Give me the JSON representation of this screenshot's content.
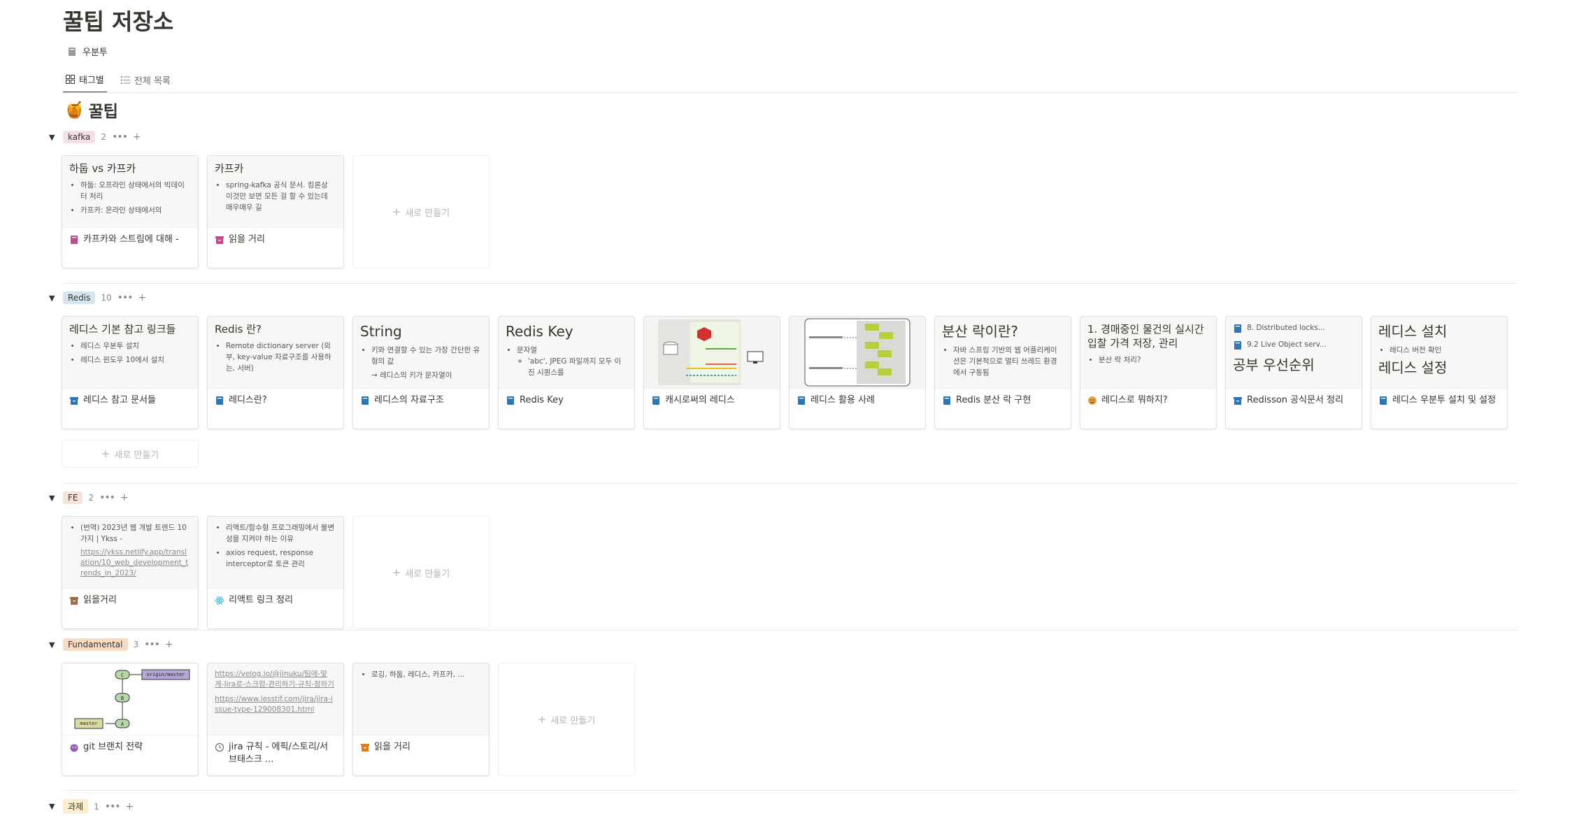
{
  "page": {
    "title": "꿀팁 저장소",
    "breadcrumb": "우분투"
  },
  "tabs": [
    {
      "label": "태그별"
    },
    {
      "label": "전체 목록"
    }
  ],
  "section": {
    "emoji": "🍯",
    "title": "꿀팁"
  },
  "common": {
    "new_label": "새로 만들기",
    "more_icon": "•••",
    "plus_icon": "+",
    "toggle_icon": "▼"
  },
  "groups": [
    {
      "tag": "kafka",
      "count": "2",
      "color": "#f5e0e9",
      "cards": [
        {
          "name": "카프카와 스트림에 대해 -",
          "icon": "book",
          "icon_color": "#c14c8a",
          "preview_title": "하둡 vs 카프카",
          "bullets": [
            "하둡: 오프라인 상태에서의 빅데이터 처리",
            "카프카: 온라인 상태에서의"
          ]
        },
        {
          "name": "읽을 거리",
          "icon": "archive",
          "icon_color": "#c14c8a",
          "preview_title": "카프카",
          "bullets": [
            "spring-kafka 공식 문서. 킹론상 이것만 보면 모든 걸 할 수 있는데 매우매우 길"
          ]
        }
      ]
    },
    {
      "tag": "Redis",
      "count": "10",
      "color": "#d3e5ef",
      "cards": [
        {
          "name": "레디스 참고 문서들",
          "icon": "archive",
          "icon_color": "#2e75b6",
          "preview_title": "레디스 기본 참고 링크들",
          "bullets": [
            "레디스 우분투 설치",
            "레디스 윈도우 10에서 설치"
          ]
        },
        {
          "name": "레디스란?",
          "icon": "book",
          "icon_color": "#2e75b6",
          "preview_title": "Redis 란?",
          "bullets": [
            "Remote dictionary server (외부, key-value 자료구조를 사용하는, 서버)"
          ]
        },
        {
          "name": "레디스의 자료구조",
          "icon": "book",
          "icon_color": "#2e75b6",
          "preview_title": "String",
          "bullets": [
            "키와 연결할 수 있는 가장 간단한 유형의 값"
          ],
          "extra": "→ 레디스의 키가 문자열이"
        },
        {
          "name": "Redis Key",
          "icon": "book",
          "icon_color": "#2e75b6",
          "preview_title": "Redis Key",
          "bullets": [
            "문자열"
          ],
          "sub": "'abc', JPEG 파일까지 모두 이진 시퀀스를"
        },
        {
          "name": "캐시로써의 레디스",
          "icon": "book",
          "icon_color": "#2e75b6",
          "image": "cache"
        },
        {
          "name": "레디스 활용 사례",
          "icon": "book",
          "icon_color": "#2e75b6",
          "image": "usecase"
        },
        {
          "name": "Redis 분산 락 구현",
          "icon": "book",
          "icon_color": "#2e75b6",
          "preview_title": "분산 락이란?",
          "bullets": [
            "자바 스프링 기반의 웹 어플리케이션은 기본적으로 멀티 쓰레드 환경에서 구동됨"
          ]
        },
        {
          "name": "레디스로 뭐하지?",
          "icon": "face",
          "icon_color": "#e9a23b",
          "preview_title": "1. 경매중인 물건의 실시간 입찰 가격 저장, 관리",
          "bullets": [
            "분산 락 처리?"
          ]
        },
        {
          "name": "Redisson 공식문서 정리",
          "icon": "archive",
          "icon_color": "#2e75b6",
          "links": [
            "8. Distributed locks...",
            "9.2 Live Object serv..."
          ],
          "preview_title": "공부 우선순위"
        },
        {
          "name": "레디스 우분투 설치 및 설정",
          "icon": "book",
          "icon_color": "#2e75b6",
          "preview_title": "레디스 설치",
          "bullets": [
            "레디스 버전 확인"
          ],
          "extra": "레디스 설정"
        }
      ]
    },
    {
      "tag": "FE",
      "count": "2",
      "color": "#f3e3d6",
      "cards": [
        {
          "name": "읽을거리",
          "icon": "archive",
          "icon_color": "#9a6a4a",
          "bullets": [
            "(번역) 2023년 웹 개발 트렌드 10가지 | Ykss -"
          ],
          "link": "https://ykss.netlify.app/translation/10_web_development_trends_in_2023/"
        },
        {
          "name": "리액트 링크 정리",
          "icon": "react",
          "icon_color": "#4bc0e0",
          "bullets": [
            "리액트/함수형 프로그래밍에서 불변성을 지켜야 하는 이유",
            "axios request, response interceptor로 토큰 관리"
          ]
        }
      ]
    },
    {
      "tag": "Fundamental",
      "count": "3",
      "color": "#f6dcc5",
      "cards": [
        {
          "name": "git 브랜치 전략",
          "icon": "devil",
          "icon_color": "#9b59b6",
          "image": "git",
          "git": {
            "c": "C",
            "b": "B",
            "a": "A",
            "origin": "origin/master",
            "master": "master"
          }
        },
        {
          "name": "jira 규칙 - 에픽/스토리/서브태스크 ...",
          "icon": "clock",
          "icon_color": "#777777",
          "links": [
            "https://velog.io/@jinuku/팀에-맞게-Jira로-스크럼-관리하기-규칙-정하기",
            "https://www.lesstif.com/jira/jira-issue-type-129008301.html"
          ]
        },
        {
          "name": "읽을 거리",
          "icon": "archive",
          "icon_color": "#e07b1f",
          "bullets": [
            "로깅, 하둡, 레디스, 카프카, ..."
          ]
        }
      ]
    },
    {
      "tag": "과제",
      "count": "1",
      "color": "#fbeecc",
      "cards": []
    }
  ]
}
